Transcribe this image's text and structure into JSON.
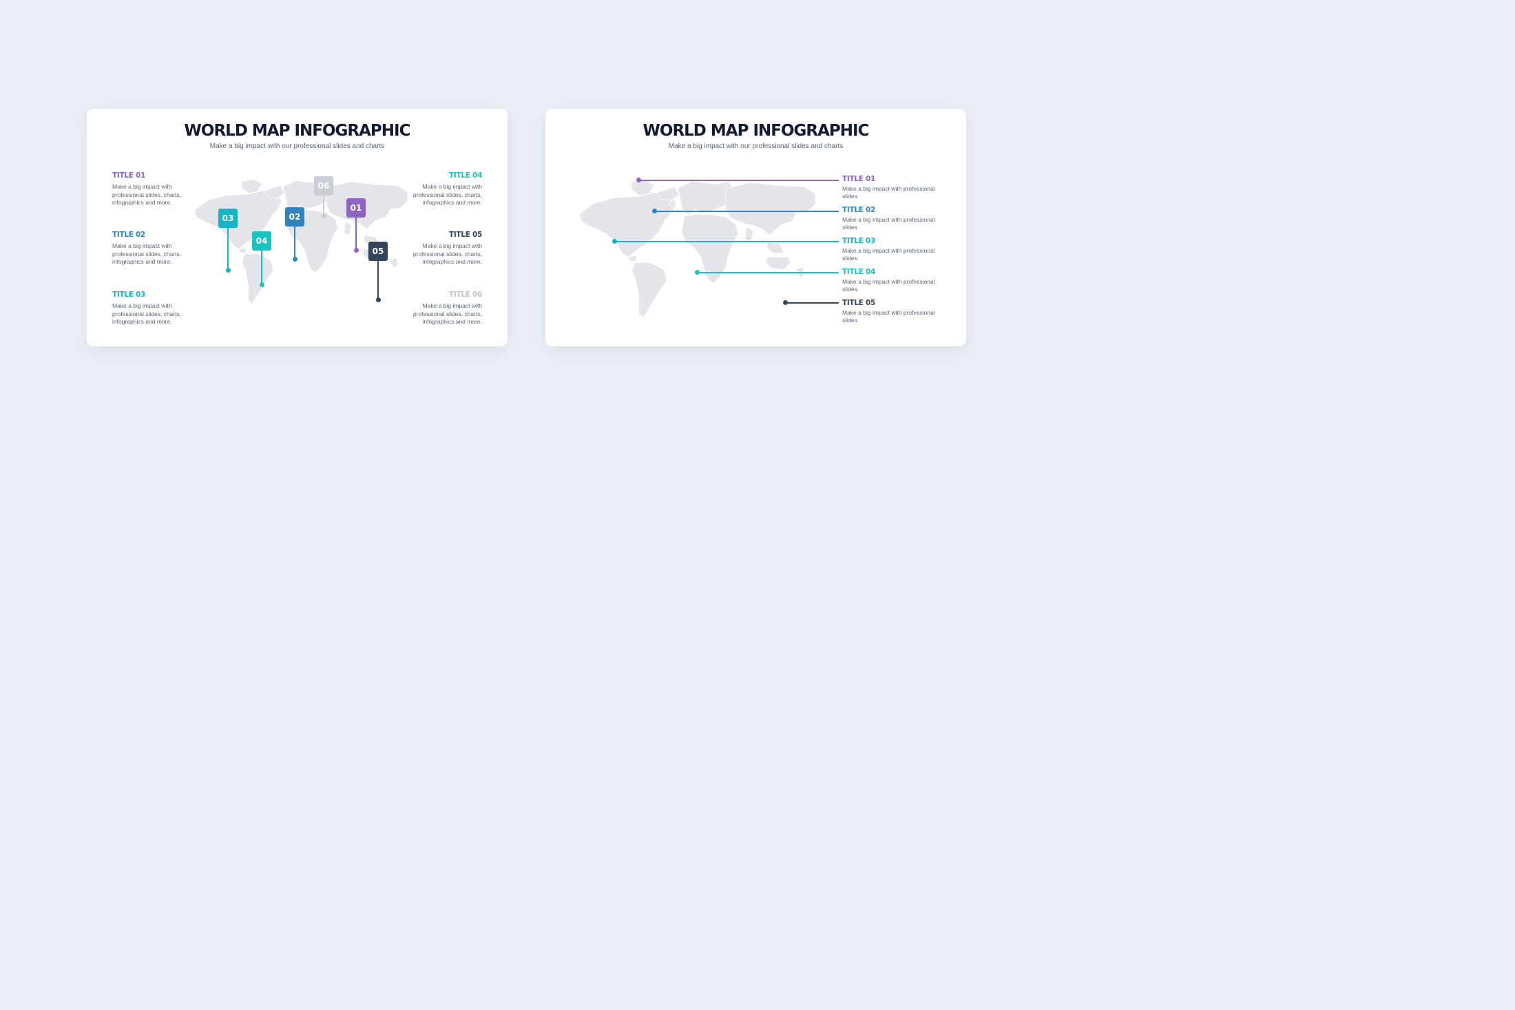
{
  "slides": [
    {
      "title": "WORLD MAP INFOGRAPHIC",
      "subtitle": "Make a big impact with our professional slides and charts",
      "left_items": [
        {
          "title": "TITLE 01",
          "text": "Make a big impact with professional slides, charts, infographics and more."
        },
        {
          "title": "TITLE 02",
          "text": "Make a big impact with professional slides, charts, infographics and more."
        },
        {
          "title": "TITLE 03",
          "text": "Make a big impact with professional slides, charts, infographics and more."
        }
      ],
      "right_items": [
        {
          "title": "TITLE 04",
          "text": "Make a big impact with professional slides, charts, infographics and more."
        },
        {
          "title": "TITLE 05",
          "text": "Make a big impact with professional slides, charts, infographics and more."
        },
        {
          "title": "TITLE 06",
          "text": "Make a big impact with professional slides, charts, infographics and more."
        }
      ],
      "pins": [
        "01",
        "02",
        "03",
        "04",
        "05",
        "06"
      ]
    },
    {
      "title": "WORLD MAP INFOGRAPHIC",
      "subtitle": "Make a big impact with our professional slides and charts",
      "items": [
        {
          "title": "TITLE 01",
          "text": "Make a big impact with professional slides."
        },
        {
          "title": "TITLE 02",
          "text": "Make a big impact with professional slides."
        },
        {
          "title": "TITLE 03",
          "text": "Make a big impact with professional slides."
        },
        {
          "title": "TITLE 04",
          "text": "Make a big impact with professional slides."
        },
        {
          "title": "TITLE 05",
          "text": "Make a big impact with professional slides."
        }
      ]
    }
  ],
  "colors": {
    "background": "#eaeff7",
    "title_text": "#141a33",
    "map_land": "#e3e5ea",
    "purple": "#8e63c4",
    "blue": "#2f84bf",
    "teal": "#13b6c7",
    "teal_light": "#1cc2c0",
    "navy": "#34445c",
    "gray": "#c9ccd3"
  }
}
